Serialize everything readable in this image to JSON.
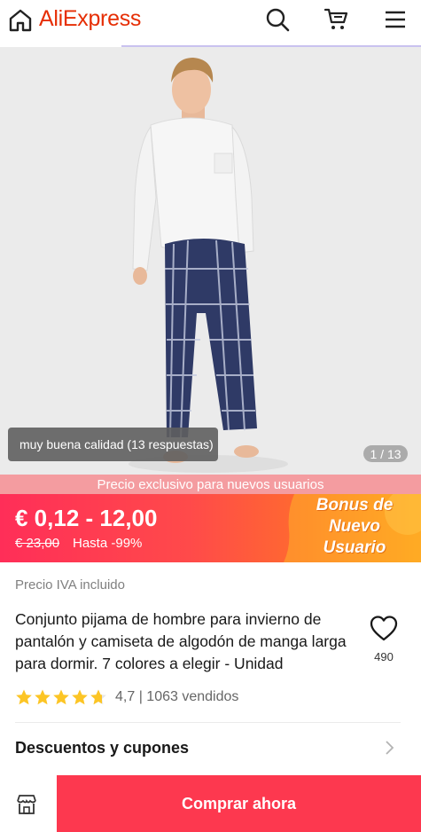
{
  "header": {
    "logo": "AliExpress",
    "icons": [
      "home-icon",
      "search-icon",
      "cart-icon",
      "menu-icon"
    ]
  },
  "gallery": {
    "review_label": "muy buena calidad (13 respuestas)",
    "counter": "1 / 13"
  },
  "promo": {
    "banner_text": "Precio exclusivo para nuevos usuarios",
    "price_range": "€ 0,12 - 12,00",
    "original_price": "€ 23,00",
    "discount": "Hasta -99%",
    "bonus_line1": "Bonus de",
    "bonus_line2": "Nuevo",
    "bonus_line3": "Usuario"
  },
  "product": {
    "vat_note": "Precio IVA incluido",
    "title": "Conjunto pijama de hombre para invierno de pantalón y camiseta de algodón de manga larga para dormir. 7 colores a elegir - Unidad",
    "wishlist_count": "490",
    "rating_value": 4.7,
    "rating_text": "4,7 | 1063 vendidos"
  },
  "coupons": {
    "label": "Descuentos y cupones"
  },
  "bottom_bar": {
    "buy_label": "Comprar ahora"
  },
  "colors": {
    "brand": "#e62e04",
    "buy_button": "#fd384f",
    "star": "#fcc525"
  }
}
